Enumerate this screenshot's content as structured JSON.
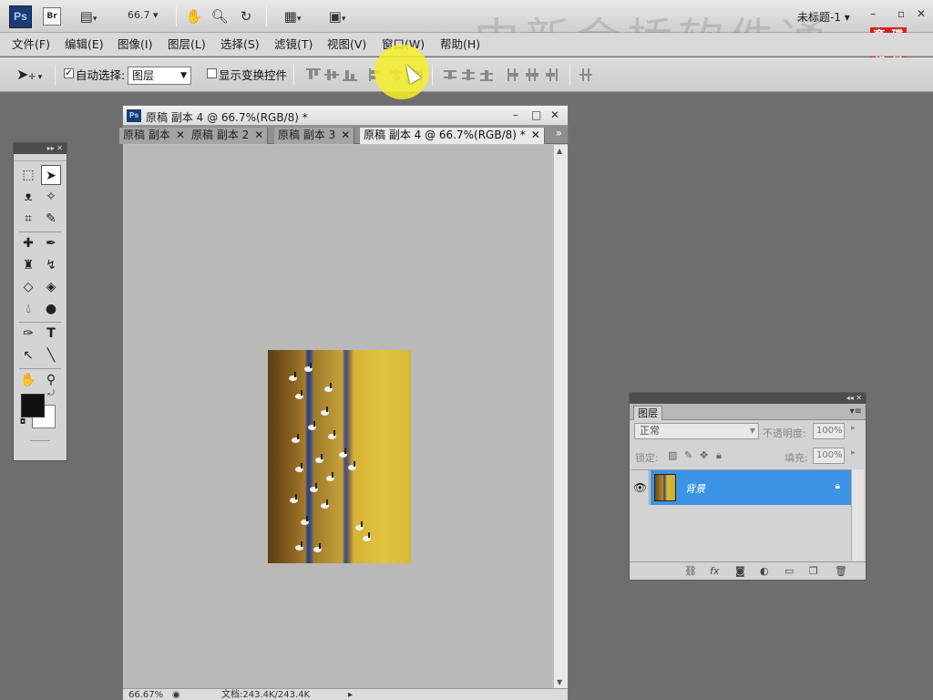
{
  "appbar": {
    "ps_logo": "Ps",
    "br_logo": "Br",
    "zoom": "66.7",
    "doc_title": "未标题-1",
    "watermark": "中新金桥软件通",
    "brand": [
      "育",
      "碟",
      "教",
      "育"
    ]
  },
  "menu": [
    "文件(F)",
    "编辑(E)",
    "图像(I)",
    "图层(L)",
    "选择(S)",
    "滤镜(T)",
    "视图(V)",
    "窗口(W)",
    "帮助(H)"
  ],
  "options": {
    "auto_select_label": "自动选择:",
    "auto_select_checked": true,
    "auto_select_value": "图层",
    "show_transform_label": "显示变换控件",
    "show_transform_checked": false
  },
  "document": {
    "title": "原稿 副本 4 @ 66.7%(RGB/8) *",
    "tabs": [
      {
        "label": "原稿 副本",
        "active": false
      },
      {
        "label": "原稿 副本 2",
        "active": false
      },
      {
        "label": "原稿 副本 3",
        "active": false
      },
      {
        "label": "原稿 副本 4 @ 66.7%(RGB/8) *",
        "active": true
      }
    ],
    "status_zoom": "66.67%",
    "status_doc": "文档:243.4K/243.4K"
  },
  "layers_panel": {
    "tab": "图层",
    "blend_mode": "正常",
    "opacity_label": "不透明度:",
    "opacity": "100%",
    "lock_label": "锁定:",
    "fill_label": "填充:",
    "fill": "100%",
    "layers": [
      {
        "name": "背景",
        "locked": true,
        "visible": true,
        "selected": true
      }
    ]
  },
  "colors": {
    "accent": "#3b93e6",
    "highlight": "#f5f028",
    "brand_red": "#d32222"
  }
}
